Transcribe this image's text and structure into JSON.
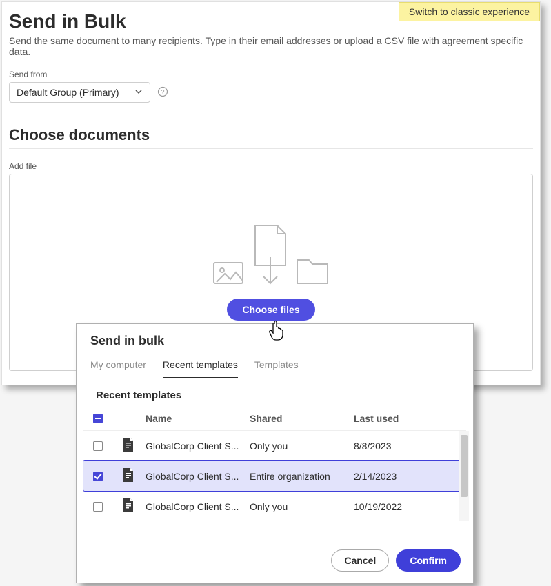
{
  "header": {
    "classic_link": "Switch to classic experience",
    "title": "Send in Bulk",
    "subtitle": "Send the same document to many recipients. Type in their email addresses or upload a CSV file with agreement specific data."
  },
  "send_from": {
    "label": "Send from",
    "value": "Default Group (Primary)"
  },
  "documents": {
    "section_title": "Choose documents",
    "add_file_label": "Add file",
    "choose_files_btn": "Choose files"
  },
  "modal": {
    "title": "Send in bulk",
    "tabs": [
      "My computer",
      "Recent templates",
      "Templates"
    ],
    "active_tab_index": 1,
    "list_title": "Recent templates",
    "columns": {
      "name": "Name",
      "shared": "Shared",
      "last_used": "Last used"
    },
    "rows": [
      {
        "name": "GlobalCorp Client S...",
        "shared": "Only you",
        "last_used": "8/8/2023",
        "checked": false
      },
      {
        "name": "GlobalCorp Client S...",
        "shared": "Entire organization",
        "last_used": "2/14/2023",
        "checked": true
      },
      {
        "name": "GlobalCorp Client S...",
        "shared": "Only you",
        "last_used": "10/19/2022",
        "checked": false
      }
    ],
    "footer": {
      "cancel": "Cancel",
      "confirm": "Confirm"
    }
  }
}
